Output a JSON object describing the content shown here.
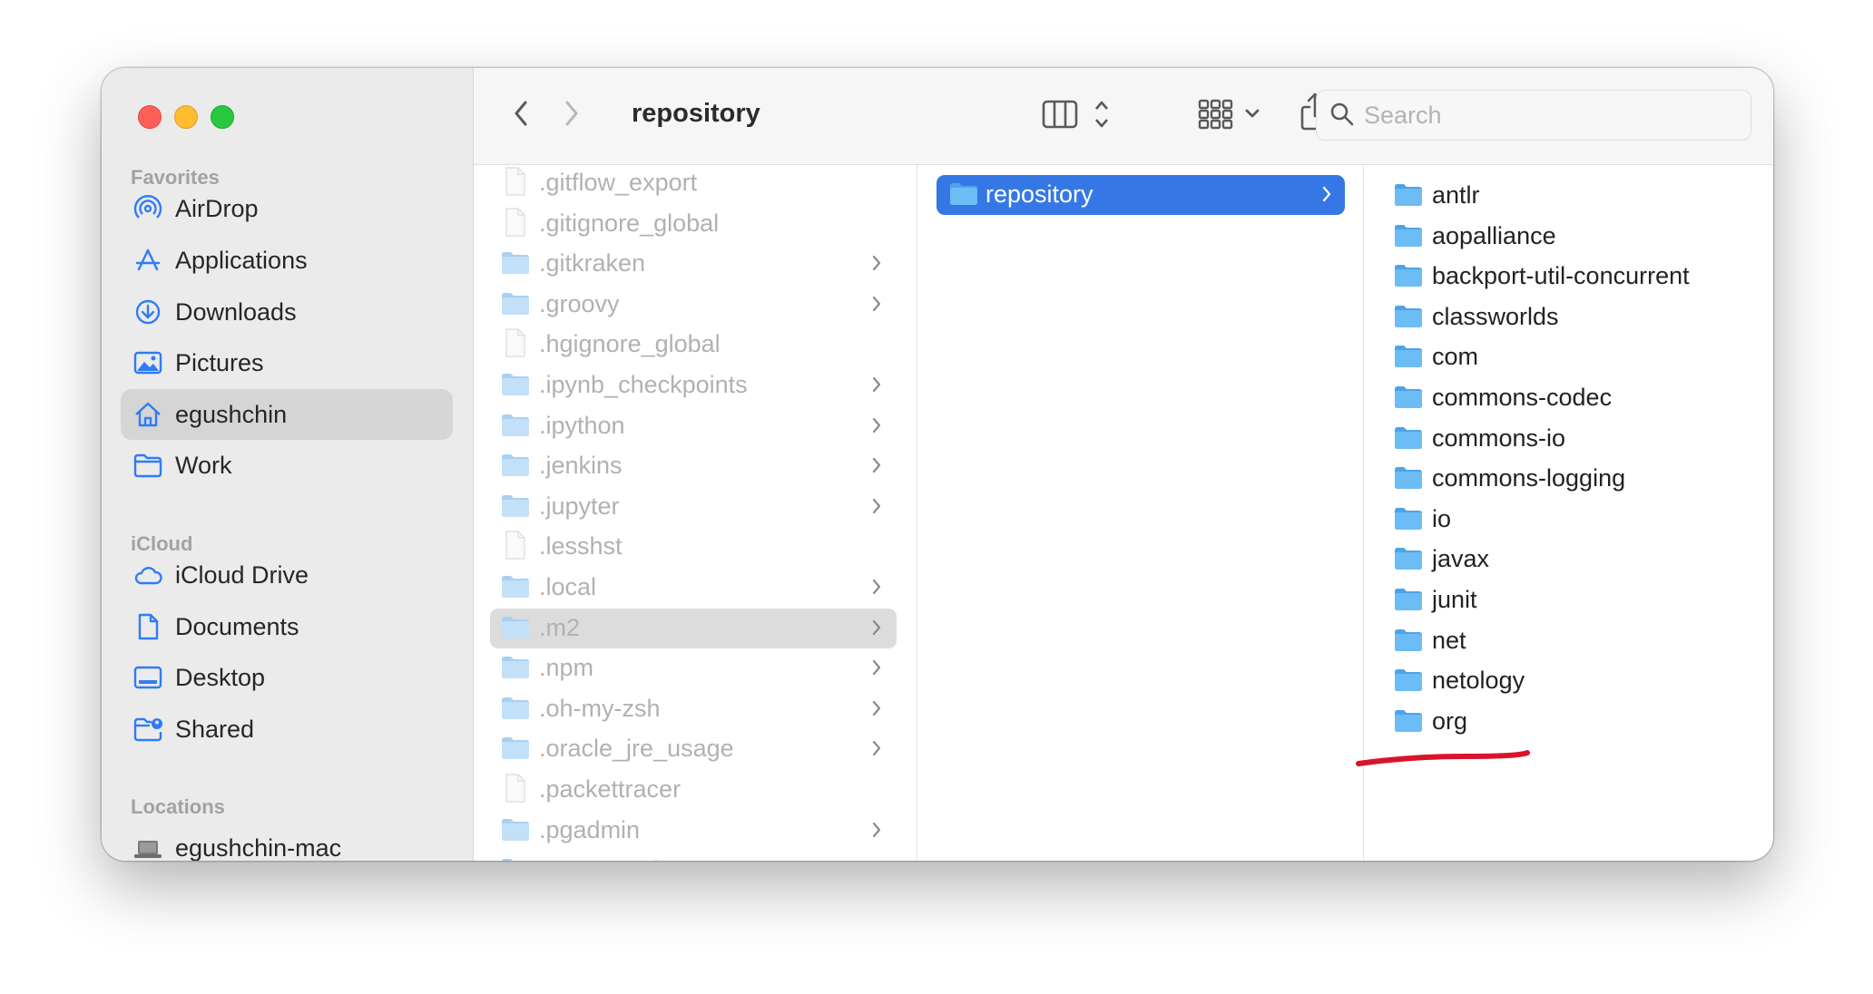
{
  "window": {
    "title": "repository",
    "search_placeholder": "Search"
  },
  "sidebar": {
    "sections": [
      {
        "title": "Favorites",
        "items": [
          {
            "label": "AirDrop",
            "icon": "airdrop-icon"
          },
          {
            "label": "Applications",
            "icon": "applications-icon"
          },
          {
            "label": "Downloads",
            "icon": "downloads-icon"
          },
          {
            "label": "Pictures",
            "icon": "pictures-icon"
          },
          {
            "label": "egushchin",
            "icon": "home-icon",
            "selected": true
          },
          {
            "label": "Work",
            "icon": "folder-icon"
          }
        ]
      },
      {
        "title": "iCloud",
        "items": [
          {
            "label": "iCloud Drive",
            "icon": "cloud-icon"
          },
          {
            "label": "Documents",
            "icon": "document-icon"
          },
          {
            "label": "Desktop",
            "icon": "desktop-icon"
          },
          {
            "label": "Shared",
            "icon": "shared-folder-icon"
          }
        ]
      },
      {
        "title": "Locations",
        "items": [
          {
            "label": "egushchin-mac",
            "icon": "laptop-icon"
          }
        ]
      }
    ]
  },
  "columns": {
    "home": [
      {
        "label": ".gitflow_export",
        "kind": "file"
      },
      {
        "label": ".gitignore_global",
        "kind": "file"
      },
      {
        "label": ".gitkraken",
        "kind": "folder"
      },
      {
        "label": ".groovy",
        "kind": "folder"
      },
      {
        "label": ".hgignore_global",
        "kind": "file"
      },
      {
        "label": ".ipynb_checkpoints",
        "kind": "folder"
      },
      {
        "label": ".ipython",
        "kind": "folder"
      },
      {
        "label": ".jenkins",
        "kind": "folder"
      },
      {
        "label": ".jupyter",
        "kind": "folder"
      },
      {
        "label": ".lesshst",
        "kind": "file"
      },
      {
        "label": ".local",
        "kind": "folder"
      },
      {
        "label": ".m2",
        "kind": "folder",
        "selected": true
      },
      {
        "label": ".npm",
        "kind": "folder"
      },
      {
        "label": ".oh-my-zsh",
        "kind": "folder"
      },
      {
        "label": ".oracle_jre_usage",
        "kind": "folder"
      },
      {
        "label": ".packettracer",
        "kind": "file"
      },
      {
        "label": ".pgadmin",
        "kind": "folder"
      },
      {
        "label": ".postgresql",
        "kind": "folder"
      }
    ],
    "m2": [
      {
        "label": "repository",
        "kind": "folder",
        "selected": true
      }
    ],
    "repository": [
      {
        "label": "antlr"
      },
      {
        "label": "aopalliance"
      },
      {
        "label": "backport-util-concurrent"
      },
      {
        "label": "classworlds"
      },
      {
        "label": "com"
      },
      {
        "label": "commons-codec"
      },
      {
        "label": "commons-io"
      },
      {
        "label": "commons-logging"
      },
      {
        "label": "io"
      },
      {
        "label": "javax"
      },
      {
        "label": "junit"
      },
      {
        "label": "net"
      },
      {
        "label": "netology",
        "annotated": true
      },
      {
        "label": "org"
      }
    ]
  },
  "colors": {
    "selection_blue": "#3578e5",
    "folder_blue": "#5eb5f2",
    "annotation_red": "#d9142a",
    "sidebar_icon_blue": "#2f7cf6"
  }
}
